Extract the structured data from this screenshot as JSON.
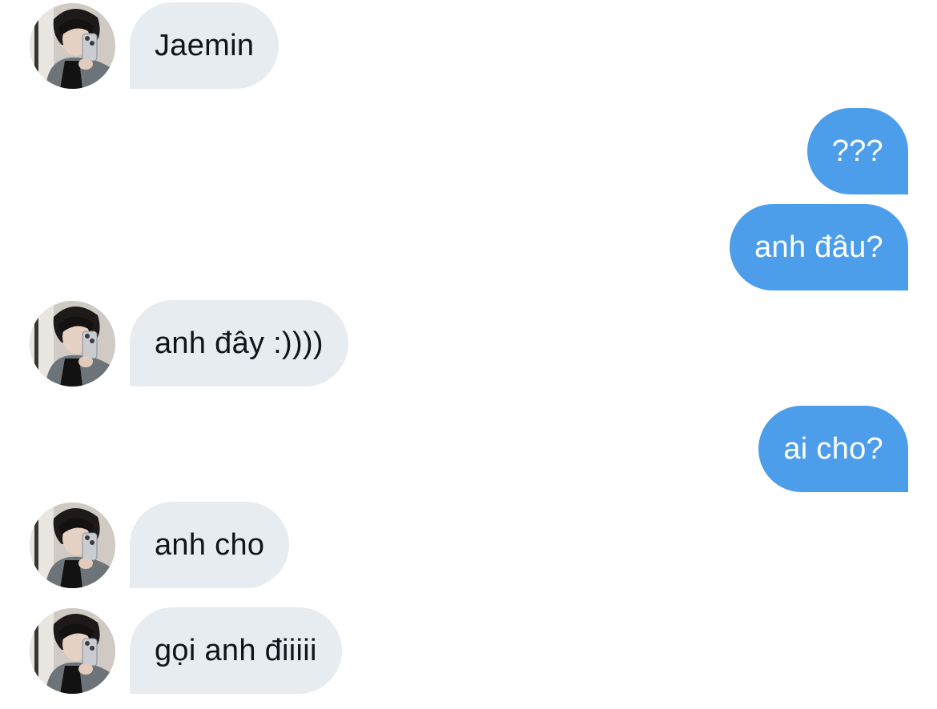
{
  "messages": [
    {
      "from": "received",
      "text": "Jaemin",
      "avatar": "user-avatar-photo"
    },
    {
      "from": "sent",
      "text": "???"
    },
    {
      "from": "sent",
      "text": "anh đâu?"
    },
    {
      "from": "received",
      "text": "anh đây :))))",
      "avatar": "user-avatar-photo"
    },
    {
      "from": "sent",
      "text": "ai cho?"
    },
    {
      "from": "received",
      "text": "anh cho",
      "avatar": "user-avatar-photo"
    },
    {
      "from": "received",
      "text": "gọi anh điiiii",
      "avatar": "user-avatar-photo"
    }
  ],
  "colors": {
    "received_bubble": "#e7ecf1",
    "received_text": "#0f1419",
    "sent_bubble": "#4c9eeb",
    "sent_text": "#ffffff",
    "background": "#ffffff"
  }
}
